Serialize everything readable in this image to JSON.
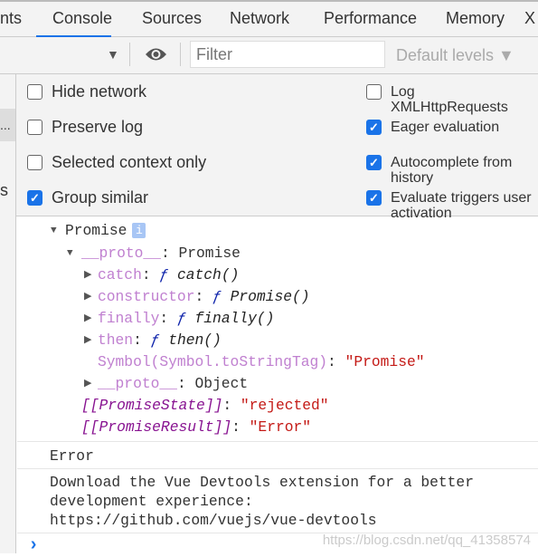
{
  "tabs": [
    {
      "label": "nts"
    },
    {
      "label": "Console",
      "active": true
    },
    {
      "label": "Sources"
    },
    {
      "label": "Network"
    },
    {
      "label": "Performance"
    },
    {
      "label": "Memory"
    },
    {
      "label": "X"
    }
  ],
  "toolbar": {
    "filter_placeholder": "Filter",
    "levels": "Default levels ▼",
    "context_arrow": "▼"
  },
  "sidebar": {
    "selected": "...",
    "item": "s"
  },
  "settings": {
    "left": [
      {
        "label": "Hide network",
        "checked": false
      },
      {
        "label": "Preserve log",
        "checked": false
      },
      {
        "label": "Selected context only",
        "checked": false
      },
      {
        "label": "Group similar",
        "checked": true
      }
    ],
    "right": [
      {
        "label": "Log XMLHttpRequests",
        "checked": false
      },
      {
        "label": "Eager evaluation",
        "checked": true
      },
      {
        "label": "Autocomplete from history",
        "checked": true
      },
      {
        "label": "Evaluate triggers user activation",
        "checked": true
      }
    ]
  },
  "console": {
    "promise_label": "Promise",
    "proto_key": "__proto__",
    "proto_val": "Promise",
    "methods": [
      {
        "key": "catch",
        "name": "catch()"
      },
      {
        "key": "constructor",
        "name": "Promise()"
      },
      {
        "key": "finally",
        "name": "finally()"
      },
      {
        "key": "then",
        "name": "then()"
      }
    ],
    "symbol_key": "Symbol(Symbol.toStringTag)",
    "symbol_val": "\"Promise\"",
    "proto2_val": "Object",
    "state_key": "[[PromiseState]]",
    "state_val": "\"rejected\"",
    "result_key": "[[PromiseResult]]",
    "result_val": "\"Error\"",
    "error_msg": "Error",
    "vue_line1": "Download the Vue Devtools extension for a better",
    "vue_line2": "development experience:",
    "vue_link": "https://github.com/vuejs/vue-devtools",
    "prompt": "›"
  },
  "watermark": "https://blog.csdn.net/qq_41358574",
  "colors": {
    "accent": "#1a73e8",
    "string": "#c41a16",
    "key": "#c080d0",
    "internal_key": "#881391"
  }
}
